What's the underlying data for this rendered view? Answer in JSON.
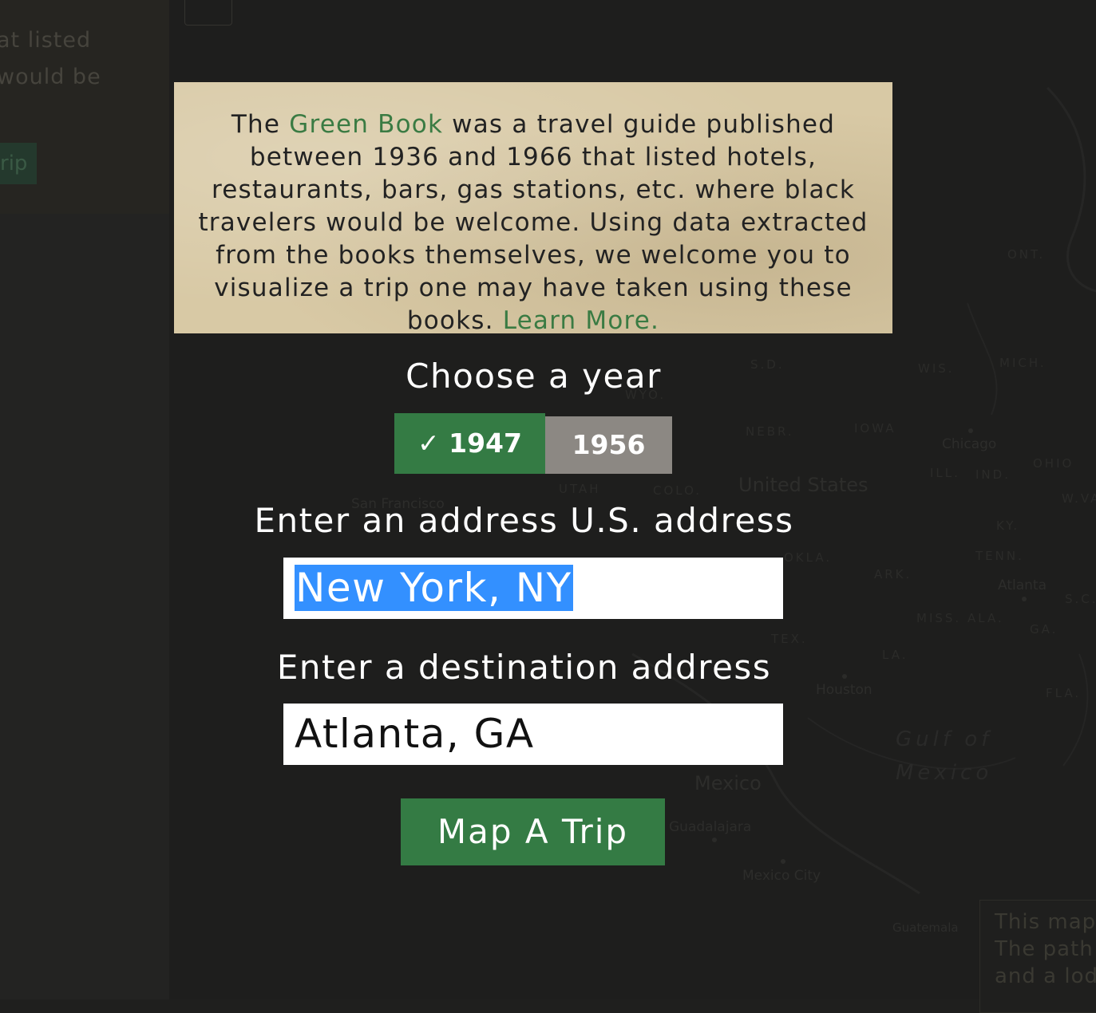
{
  "background": {
    "left_panel_fragments": [
      "at listed",
      "would be"
    ],
    "left_panel_button": "rip",
    "legend_fragments": [
      "This map",
      "The path",
      "and a lod"
    ],
    "map_labels": {
      "states": [
        "ONT.",
        "S.D.",
        "WIS.",
        "MICH.",
        "NEBR.",
        "IOWA",
        "ILL.",
        "IND.",
        "OHIO",
        "W.VA.",
        "UTAH",
        "COLO.",
        "KY.",
        "TENN.",
        "OKLA.",
        "ARK.",
        "MISS.",
        "ALA.",
        "GA.",
        "S.C.",
        "TEX.",
        "LA.",
        "FLA.",
        "WYO."
      ],
      "countries": [
        "United States",
        "Mexico"
      ],
      "cities": [
        "Chicago",
        "San Francisco",
        "Atlanta",
        "Houston",
        "Guadalajara",
        "Mexico City",
        "Guatemala"
      ],
      "water": [
        "Gulf of",
        "Mexico"
      ]
    }
  },
  "intro": {
    "text_before": "The ",
    "link_green_book": "Green Book",
    "text_middle": " was a travel guide published between 1936 and 1966 that listed hotels, restaurants, bars, gas stations, etc. where black travelers would be welcome. Using data extracted from the books themselves, we welcome you to visualize a trip one may have taken using these books. ",
    "link_learn_more": "Learn More."
  },
  "form": {
    "year_heading": "Choose a year",
    "years": [
      {
        "label": "✓ 1947",
        "selected": true
      },
      {
        "label": "1956",
        "selected": false
      }
    ],
    "origin_heading": "Enter an address U.S. address",
    "origin_value": "New York, NY",
    "destination_heading": "Enter a destination address",
    "destination_value": "Atlanta, GA",
    "submit_label": "Map A Trip"
  },
  "colors": {
    "accent_green": "#347b44",
    "link_green": "#3a7b43",
    "unselected_year": "#8c8883",
    "intro_paper": "#d8c9a5",
    "selection_blue": "#3390ff"
  }
}
